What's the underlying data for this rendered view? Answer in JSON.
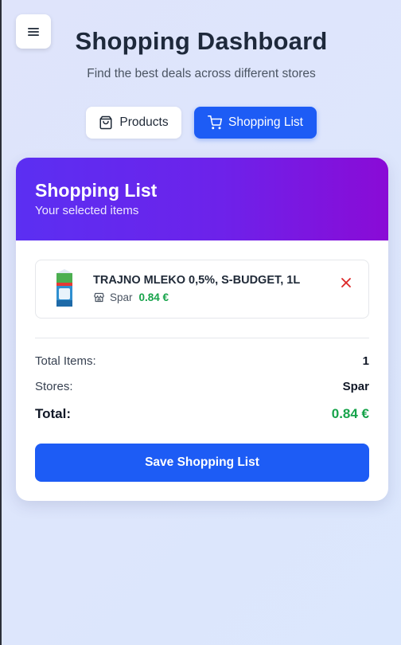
{
  "header": {
    "title": "Shopping Dashboard",
    "subtitle": "Find the best deals across different stores"
  },
  "menu": {
    "icon": "hamburger-icon"
  },
  "tabs": [
    {
      "label": "Products",
      "icon": "shopping-bag-icon",
      "active": false
    },
    {
      "label": "Shopping List",
      "icon": "shopping-cart-icon",
      "active": true
    }
  ],
  "list": {
    "title": "Shopping List",
    "subtitle": "Your selected items",
    "items": [
      {
        "name": "TRAJNO MLEKO 0,5%, S-BUDGET, 1L",
        "store": "Spar",
        "price": "0.84 €",
        "store_icon": "store-icon",
        "remove_icon": "close-icon"
      }
    ],
    "summary": {
      "total_items_label": "Total Items:",
      "total_items_value": "1",
      "stores_label": "Stores:",
      "stores_value": "Spar",
      "total_label": "Total:",
      "total_value": "0.84 €"
    },
    "save_label": "Save Shopping List"
  },
  "colors": {
    "primary": "#1d5cf5",
    "gradient_start": "#5b2ff2",
    "gradient_end": "#8a0bd6",
    "price": "#16a34a",
    "remove": "#dc2626"
  }
}
